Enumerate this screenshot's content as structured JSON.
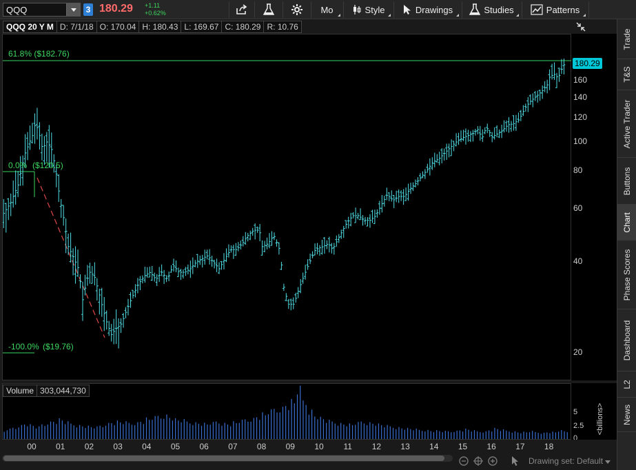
{
  "toolbar": {
    "symbol": "QQQ",
    "linked_badge": "3",
    "last_price": "180.29",
    "net_change": "+1.11",
    "percent_change": "+0.62%",
    "aggregation": "Mo",
    "style_label": "Style",
    "drawings_label": "Drawings",
    "studies_label": "Studies",
    "patterns_label": "Patterns"
  },
  "chart_header": {
    "title": "QQQ 20 Y M",
    "date": "D: 7/1/18",
    "open": "O: 170.04",
    "high": "H: 180.43",
    "low": "L: 169.67",
    "close": "C: 180.29",
    "range": "R: 10.76"
  },
  "fibonacci": {
    "top": "61.8%  ($182.76)",
    "mid_pct": "0.0%",
    "mid_price": "($120.5)",
    "low_pct": "-100.0%",
    "low_price": "($19.76)"
  },
  "volume_header": {
    "label": "Volume",
    "value": "303,044,730"
  },
  "volume_axis": {
    "labels": [
      "5",
      "2.5",
      "0"
    ],
    "unit": "<billions>"
  },
  "bottom_bar": {
    "drawing_set": "Drawing set: Default"
  },
  "sidebar": {
    "tabs": [
      "Trade",
      "T&S",
      "Active Trader",
      "Buttons",
      "Chart",
      "Phase Scores",
      "Dashboard",
      "L2",
      "News"
    ]
  },
  "colors": {
    "bars": "#4fe0e8",
    "fib_line": "#3dd65e",
    "trendline": "#e04848",
    "volume": "#3a6fd0",
    "last_price": "#ff6b6b",
    "positive": "#3dd65e",
    "price_bubble": "#00c8d8"
  },
  "chart_data": [
    {
      "type": "bar",
      "title": "QQQ 20 Y M",
      "series_kind": "OHLC monthly",
      "x": [
        "00",
        "01",
        "02",
        "03",
        "04",
        "05",
        "06",
        "07",
        "08",
        "09",
        "10",
        "11",
        "12",
        "13",
        "14",
        "15",
        "16",
        "17",
        "18"
      ],
      "y_ticks": [
        "20",
        "40",
        "60",
        "80",
        "100",
        "120",
        "140",
        "160"
      ],
      "ylim": [
        14,
        188
      ],
      "last_value": "180.29",
      "points": [
        [
          1998.5,
          50
        ],
        [
          1998.75,
          54
        ],
        [
          1999.0,
          58
        ],
        [
          1999.25,
          63
        ],
        [
          1999.5,
          72
        ],
        [
          1999.75,
          92
        ],
        [
          2000.0,
          105
        ],
        [
          2000.1,
          115
        ],
        [
          2000.2,
          110
        ],
        [
          2000.35,
          95
        ],
        [
          2000.5,
          100
        ],
        [
          2000.65,
          96
        ],
        [
          2000.8,
          82
        ],
        [
          2000.95,
          65
        ],
        [
          2001.1,
          55
        ],
        [
          2001.25,
          45
        ],
        [
          2001.4,
          42
        ],
        [
          2001.6,
          38
        ],
        [
          2001.75,
          30
        ],
        [
          2001.9,
          35
        ],
        [
          2002.0,
          37
        ],
        [
          2002.15,
          36
        ],
        [
          2002.3,
          32
        ],
        [
          2002.45,
          28
        ],
        [
          2002.6,
          25
        ],
        [
          2002.75,
          23
        ],
        [
          2002.9,
          24
        ],
        [
          2003.1,
          25
        ],
        [
          2003.3,
          28
        ],
        [
          2003.5,
          31
        ],
        [
          2003.7,
          34
        ],
        [
          2003.9,
          36
        ],
        [
          2004.1,
          37
        ],
        [
          2004.3,
          35
        ],
        [
          2004.5,
          37
        ],
        [
          2004.7,
          35
        ],
        [
          2004.9,
          39
        ],
        [
          2005.1,
          37
        ],
        [
          2005.3,
          37
        ],
        [
          2005.5,
          38
        ],
        [
          2005.7,
          40
        ],
        [
          2005.9,
          41
        ],
        [
          2006.1,
          42
        ],
        [
          2006.3,
          40
        ],
        [
          2006.5,
          38
        ],
        [
          2006.7,
          41
        ],
        [
          2006.9,
          44
        ],
        [
          2007.1,
          44
        ],
        [
          2007.3,
          46
        ],
        [
          2007.5,
          49
        ],
        [
          2007.7,
          51
        ],
        [
          2007.9,
          51
        ],
        [
          2008.0,
          45
        ],
        [
          2008.2,
          46
        ],
        [
          2008.4,
          49
        ],
        [
          2008.6,
          44
        ],
        [
          2008.75,
          33
        ],
        [
          2008.9,
          29
        ],
        [
          2009.1,
          29
        ],
        [
          2009.25,
          32
        ],
        [
          2009.45,
          36
        ],
        [
          2009.65,
          40
        ],
        [
          2009.85,
          44
        ],
        [
          2010.1,
          45
        ],
        [
          2010.3,
          46
        ],
        [
          2010.45,
          44
        ],
        [
          2010.6,
          47
        ],
        [
          2010.8,
          51
        ],
        [
          2010.95,
          54
        ],
        [
          2011.15,
          57
        ],
        [
          2011.35,
          57
        ],
        [
          2011.55,
          55
        ],
        [
          2011.75,
          55
        ],
        [
          2011.95,
          57
        ],
        [
          2012.15,
          62
        ],
        [
          2012.35,
          67
        ],
        [
          2012.55,
          64
        ],
        [
          2012.75,
          66
        ],
        [
          2012.95,
          66
        ],
        [
          2013.15,
          70
        ],
        [
          2013.35,
          73
        ],
        [
          2013.55,
          77
        ],
        [
          2013.75,
          81
        ],
        [
          2013.95,
          86
        ],
        [
          2014.15,
          88
        ],
        [
          2014.35,
          92
        ],
        [
          2014.55,
          96
        ],
        [
          2014.75,
          100
        ],
        [
          2014.95,
          103
        ],
        [
          2015.15,
          105
        ],
        [
          2015.35,
          107
        ],
        [
          2015.5,
          110
        ],
        [
          2015.65,
          103
        ],
        [
          2015.8,
          112
        ],
        [
          2016.0,
          104
        ],
        [
          2016.15,
          106
        ],
        [
          2016.35,
          109
        ],
        [
          2016.55,
          114
        ],
        [
          2016.75,
          115
        ],
        [
          2016.95,
          119
        ],
        [
          2017.15,
          130
        ],
        [
          2017.35,
          137
        ],
        [
          2017.55,
          142
        ],
        [
          2017.75,
          148
        ],
        [
          2017.95,
          156
        ],
        [
          2018.0,
          164
        ],
        [
          2018.15,
          168
        ],
        [
          2018.3,
          163
        ],
        [
          2018.4,
          173
        ],
        [
          2018.5,
          180.29
        ]
      ]
    },
    {
      "type": "bar",
      "title": "Volume",
      "x": [
        "00",
        "01",
        "02",
        "03",
        "04",
        "05",
        "06",
        "07",
        "08",
        "09",
        "10",
        "11",
        "12",
        "13",
        "14",
        "15",
        "16",
        "17",
        "18"
      ],
      "y_ticks": [
        "0",
        "2.5",
        "5"
      ],
      "ylim": [
        0,
        7.5
      ],
      "ylabel": "<billions>",
      "values": [
        0.6,
        0.8,
        1.1,
        1.4,
        1.6,
        2.0,
        2.2,
        2.0,
        1.7,
        2.1,
        2.5,
        2.6,
        2.8,
        2.4,
        2.2,
        2.0,
        1.9,
        1.8,
        1.7,
        1.9,
        2.3,
        2.4,
        2.5,
        2.4,
        2.3,
        2.4,
        2.6,
        2.9,
        3.1,
        3.3,
        3.5,
        3.2,
        2.8,
        2.7,
        2.5,
        2.4,
        2.3,
        2.2,
        2.3,
        2.5,
        2.3,
        2.2,
        2.4,
        2.6,
        2.8,
        3.0,
        3.3,
        3.6,
        4.0,
        4.3,
        4.6,
        5.0,
        5.4,
        7.2,
        5.5,
        4.2,
        3.4,
        3.0,
        2.6,
        2.5,
        2.3,
        2.2,
        2.1,
        2.3,
        2.5,
        2.4,
        2.3,
        2.1,
        1.9,
        1.8,
        1.7,
        1.6,
        1.5,
        1.4,
        1.3,
        1.3,
        1.2,
        1.2,
        1.1,
        1.1,
        1.2,
        1.3,
        1.4,
        1.2,
        1.1,
        1.1,
        1.3,
        1.5,
        1.3,
        1.2,
        1.1,
        1.0,
        1.0,
        1.1,
        1.0,
        0.9,
        1.0,
        1.0,
        1.2,
        1.1
      ]
    }
  ]
}
